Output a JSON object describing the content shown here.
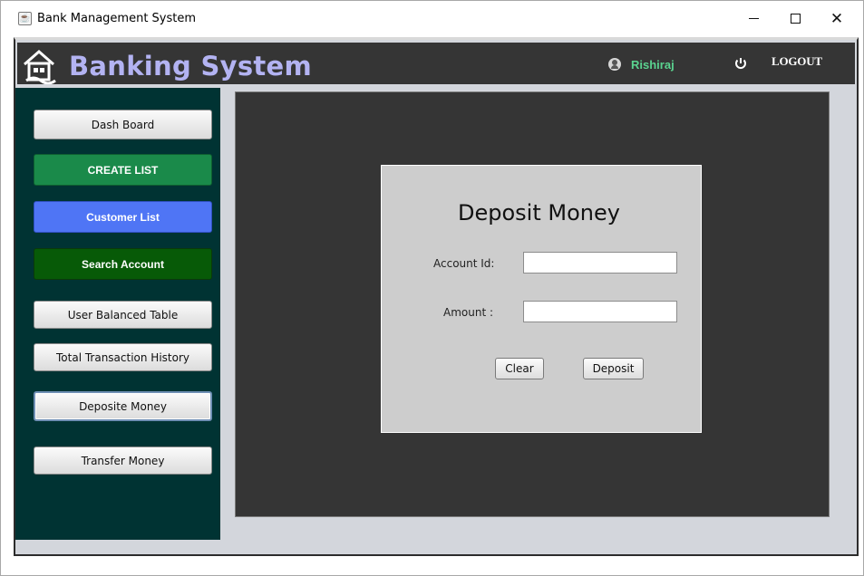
{
  "window": {
    "title": "Bank Management System",
    "icon": "java-cup-icon",
    "controls": [
      "minimize-icon",
      "maximize-icon",
      "close-icon"
    ]
  },
  "header": {
    "brand": "Banking System",
    "username": "Rishiraj",
    "logout_label": "LOGOUT",
    "colors": {
      "background": "#353535",
      "brand": "#b3b3f2",
      "username": "#5ad38f"
    }
  },
  "sidebar": {
    "items": [
      {
        "label": "Dash Board",
        "style": "default"
      },
      {
        "label": "CREATE LIST",
        "style": "green"
      },
      {
        "label": "Customer List",
        "style": "blue"
      },
      {
        "label": "Search Account",
        "style": "darkgreen"
      },
      {
        "label": "User Balanced Table",
        "style": "default"
      },
      {
        "label": "Total Transaction History",
        "style": "default"
      },
      {
        "label": "Deposite Money",
        "style": "default",
        "active": true
      },
      {
        "label": "Transfer Money",
        "style": "default"
      }
    ],
    "colors": {
      "background": "#003333",
      "green": "#1a8a4a",
      "blue": "#4f75f5",
      "darkgreen": "#075a07"
    }
  },
  "deposit_form": {
    "title": "Deposit Money",
    "account_id_label": "Account Id:",
    "account_id_value": "",
    "amount_label": "Amount :",
    "amount_value": "",
    "clear_label": "Clear",
    "deposit_label": "Deposit"
  }
}
